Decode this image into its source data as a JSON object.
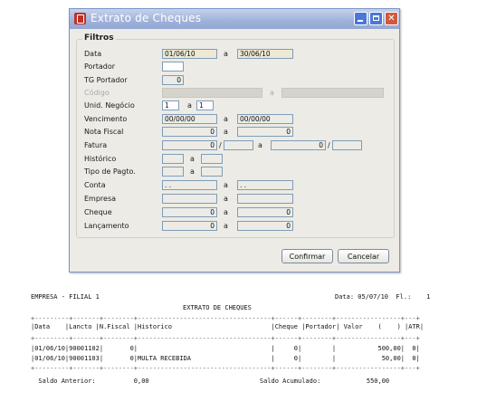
{
  "window": {
    "title": "Extrato de Cheques",
    "group_title": "Filtros",
    "fields": {
      "data_label": "Data",
      "data_from": "01/06/10",
      "data_sep": "a",
      "data_to": "30/06/10",
      "portador_label": "Portador",
      "portador_value": "",
      "tg_portador_label": "TG Portador",
      "tg_portador_value": "0",
      "codigo_label": "Código",
      "codigo_sep": "a",
      "unid_label": "Unid. Negócio",
      "unid_from": "1",
      "unid_sep": "a",
      "unid_to": "1",
      "venc_label": "Vencimento",
      "venc_from": "00/00/00",
      "venc_sep": "a",
      "venc_to": "00/00/00",
      "nota_label": "Nota Fiscal",
      "nota_from": "0",
      "nota_sep": "a",
      "nota_to": "0",
      "fatura_label": "Fatura",
      "fatura_from": "0",
      "fatura_slash1": "/",
      "fatura_sep": "a",
      "fatura_to": "0",
      "fatura_slash2": "/",
      "hist_label": "Histórico",
      "hist_sep": "a",
      "tipo_label": "Tipo de Pagto.",
      "tipo_sep": "a",
      "conta_label": "Conta",
      "conta_from": ". .",
      "conta_sep": "a",
      "conta_to": ". .",
      "empresa_label": "Empresa",
      "empresa_sep": "a",
      "cheque_label": "Cheque",
      "cheque_from": "0",
      "cheque_sep": "a",
      "cheque_to": "0",
      "lanc_label": "Lançamento",
      "lanc_from": "0",
      "lanc_sep": "a",
      "lanc_to": "0"
    },
    "buttons": {
      "confirm": "Confirmar",
      "cancel": "Cancelar"
    }
  },
  "report": {
    "company": "EMPRESA - FILIAL 1",
    "date_text": "Data: 05/07/10  Fl.:    1",
    "title": "EXTRATO DE CHEQUES",
    "rule": "+---------+-------+--------+-----------------------------------+------+--------+-----------------+---+",
    "header": "|Data    |Lancto |N.Fiscal |Historico                          |Cheque |Portador| Valor    (    ) |ATR|",
    "rule2": "+---------+-------+--------+-----------------------------------+------+--------+-----------------+---+",
    "rows": [
      "|01/06/10|90001102|       0|                                   |     0|        |           500,00|  0|",
      "|01/06/10|90001103|       0|MULTA RECEBIDA                     |     0|        |            50,00|  0|"
    ],
    "rule3": "+---------+-------+--------+-----------------------------------+------+--------+-----------------+---+",
    "saldo_line": "  Saldo Anterior:          0,00                             Saldo Acumulado:            550,00"
  }
}
